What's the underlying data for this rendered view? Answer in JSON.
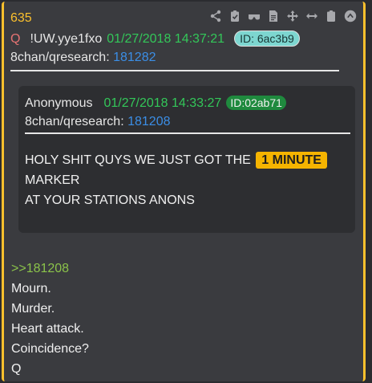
{
  "post": {
    "number": "635",
    "author_initial": "Q",
    "tripcode": "!UW.yye1fxo",
    "datetime": "01/27/2018 14:37:21",
    "id_label": "ID: 6ac3b9",
    "board_prefix": "8chan/qresearch:",
    "board_post": "181282",
    "reply_to": ">>181208",
    "lines": [
      "Mourn.",
      "Murder.",
      "Heart attack.",
      "Coincidence?",
      "Q"
    ]
  },
  "quote": {
    "author": "Anonymous",
    "datetime": "01/27/2018 14:33:27",
    "id_label": "ID:02ab71",
    "board_prefix": "8chan/qresearch:",
    "board_post": "181208",
    "text_before": "HOLY SHIT QUYS WE JUST GOT THE",
    "highlight": "1 MINUTE",
    "line2": "MARKER",
    "line3": "AT YOUR STATIONS ANONS"
  },
  "colors": {
    "accent": "#fbc02d",
    "date_green": "#33c759",
    "link_blue": "#3b8ee6",
    "id_badge": "#7dd6d0",
    "quote_id_badge": "#1f8a3e",
    "greentext": "#8bc34a"
  },
  "toolbar": {
    "icons": [
      "share-icon",
      "clipboard-check-icon",
      "glasses-icon",
      "document-icon",
      "move-icon",
      "expand-horizontal-icon",
      "clipboard-icon",
      "chevron-up-circle-icon"
    ]
  }
}
